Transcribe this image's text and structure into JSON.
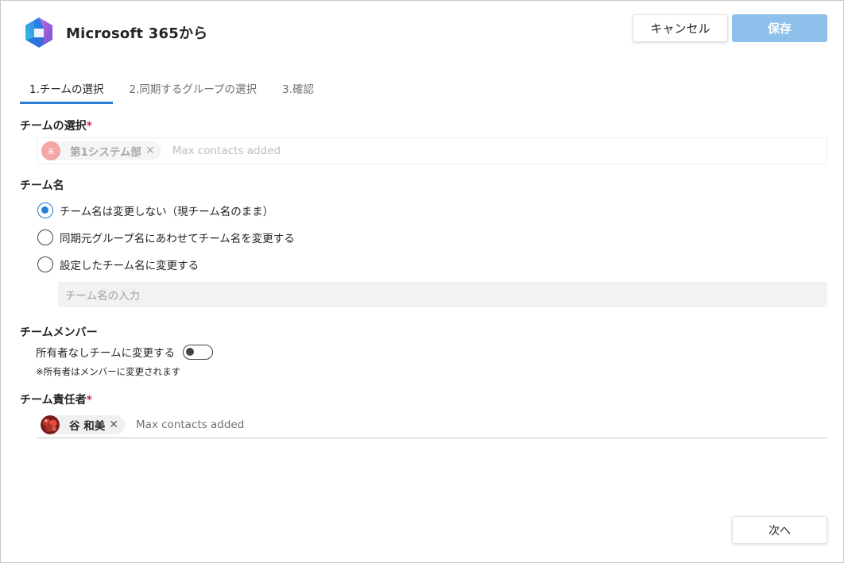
{
  "header": {
    "title": "Microsoft 365から",
    "cancel_label": "キャンセル",
    "save_label": "保存"
  },
  "tabs": [
    {
      "label": "1.チームの選択"
    },
    {
      "label": "2.同期するグループの選択"
    },
    {
      "label": "3.確認"
    }
  ],
  "team_select": {
    "label": "チームの選択",
    "required_mark": "*",
    "chip_name": "第1システム部",
    "chip_avatar": "米",
    "placeholder": "Max contacts added"
  },
  "team_name": {
    "label": "チーム名",
    "options": [
      {
        "label": "チーム名は変更しない（現チーム名のまま）",
        "selected": true
      },
      {
        "label": "同期元グループ名にあわせてチーム名を変更する",
        "selected": false
      },
      {
        "label": "設定したチーム名に変更する",
        "selected": false
      }
    ],
    "input_placeholder": "チーム名の入力"
  },
  "team_members": {
    "label": "チームメンバー",
    "toggle_label": "所有者なしチームに変更する",
    "toggle_on": false,
    "note": "※所有者はメンバーに変更されます"
  },
  "owner": {
    "label": "チーム責任者",
    "required_mark": "*",
    "chip_name": "谷 和美",
    "placeholder": "Max contacts added"
  },
  "footer": {
    "next_label": "次へ"
  },
  "colors": {
    "accent": "#2b7cd3",
    "save_disabled": "#8ec0ec",
    "required": "#c4314b"
  }
}
